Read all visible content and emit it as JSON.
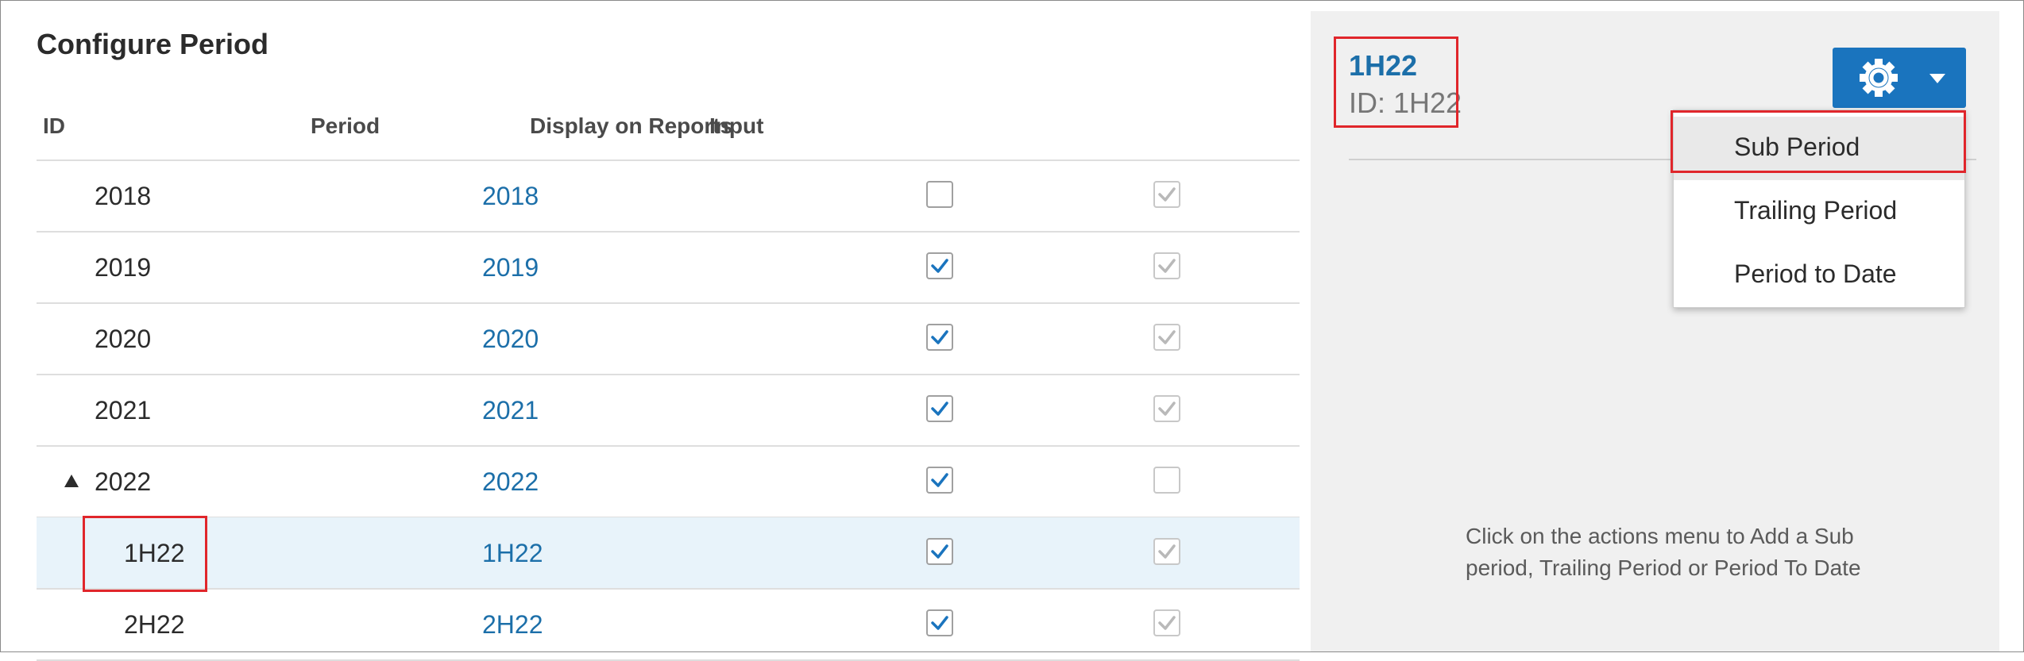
{
  "page_title": "Configure Period",
  "columns": {
    "id": "ID",
    "period": "Period",
    "display": "Display on Reports",
    "input": "Input"
  },
  "rows": [
    {
      "id": "2018",
      "period": "2018",
      "display_checked": false,
      "input_checked": true,
      "input_disabled": true,
      "expanded": false
    },
    {
      "id": "2019",
      "period": "2019",
      "display_checked": true,
      "input_checked": true,
      "input_disabled": true
    },
    {
      "id": "2020",
      "period": "2020",
      "display_checked": true,
      "input_checked": true,
      "input_disabled": true
    },
    {
      "id": "2021",
      "period": "2021",
      "display_checked": true,
      "input_checked": true,
      "input_disabled": true
    },
    {
      "id": "2022",
      "period": "2022",
      "display_checked": true,
      "input_checked": false,
      "input_disabled": true,
      "expander": "collapse-triangle-icon"
    },
    {
      "id": "1H22",
      "period": "1H22",
      "display_checked": true,
      "input_checked": true,
      "input_disabled": true,
      "selected": true
    },
    {
      "id": "2H22",
      "period": "2H22",
      "display_checked": true,
      "input_checked": true,
      "input_disabled": true
    }
  ],
  "detail": {
    "title": "1H22",
    "id_line": "ID: 1H22"
  },
  "actions_menu": {
    "icon": "gear-icon",
    "items": [
      "Sub Period",
      "Trailing Period",
      "Period to Date"
    ],
    "highlighted": "Sub Period"
  },
  "hint": "Click on the actions menu to Add a Sub period, Trailing Period or Period To Date",
  "colors": {
    "accent": "#1a74be",
    "link": "#1c6fa9",
    "highlight_box": "#e0262b",
    "selected_row": "#e8f3fa",
    "check": "#1a74be"
  }
}
